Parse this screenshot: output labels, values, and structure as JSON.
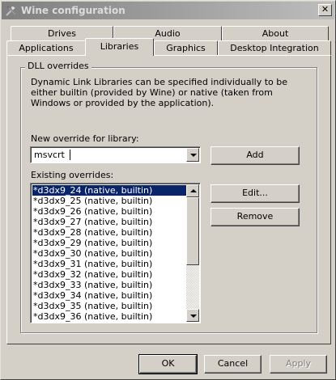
{
  "window": {
    "title": "Wine configuration",
    "close_symbol": "✕"
  },
  "tabs_back": [
    "Drives",
    "Audio",
    "About"
  ],
  "tabs_front": [
    "Applications",
    "Libraries",
    "Graphics",
    "Desktop Integration"
  ],
  "active_tab": "Libraries",
  "group": {
    "title": "DLL overrides",
    "description": "Dynamic Link Libraries can be specified individually to be either builtin (provided by Wine) or native (taken from Windows or provided by the application)."
  },
  "new_override": {
    "label": "New override for library:",
    "value": "msvcrt",
    "add_label": "Add"
  },
  "existing": {
    "label": "Existing overrides:",
    "items": [
      "*d3dx9_24 (native, builtin)",
      "*d3dx9_25 (native, builtin)",
      "*d3dx9_26 (native, builtin)",
      "*d3dx9_27 (native, builtin)",
      "*d3dx9_28 (native, builtin)",
      "*d3dx9_29 (native, builtin)",
      "*d3dx9_30 (native, builtin)",
      "*d3dx9_31 (native, builtin)",
      "*d3dx9_32 (native, builtin)",
      "*d3dx9_33 (native, builtin)",
      "*d3dx9_34 (native, builtin)",
      "*d3dx9_35 (native, builtin)",
      "*d3dx9_36 (native, builtin)"
    ],
    "selected_index": 0,
    "edit_label": "Edit...",
    "remove_label": "Remove"
  },
  "footer": {
    "ok_label": "OK",
    "cancel_label": "Cancel",
    "apply_label": "Apply"
  },
  "colors": {
    "face": "#d4d0c8",
    "selection": "#0a246a",
    "title_gradient_start": "#7f7f7f",
    "title_gradient_end": "#bdbdbd"
  },
  "icons": {
    "app": "wine-glass-tools-icon"
  }
}
